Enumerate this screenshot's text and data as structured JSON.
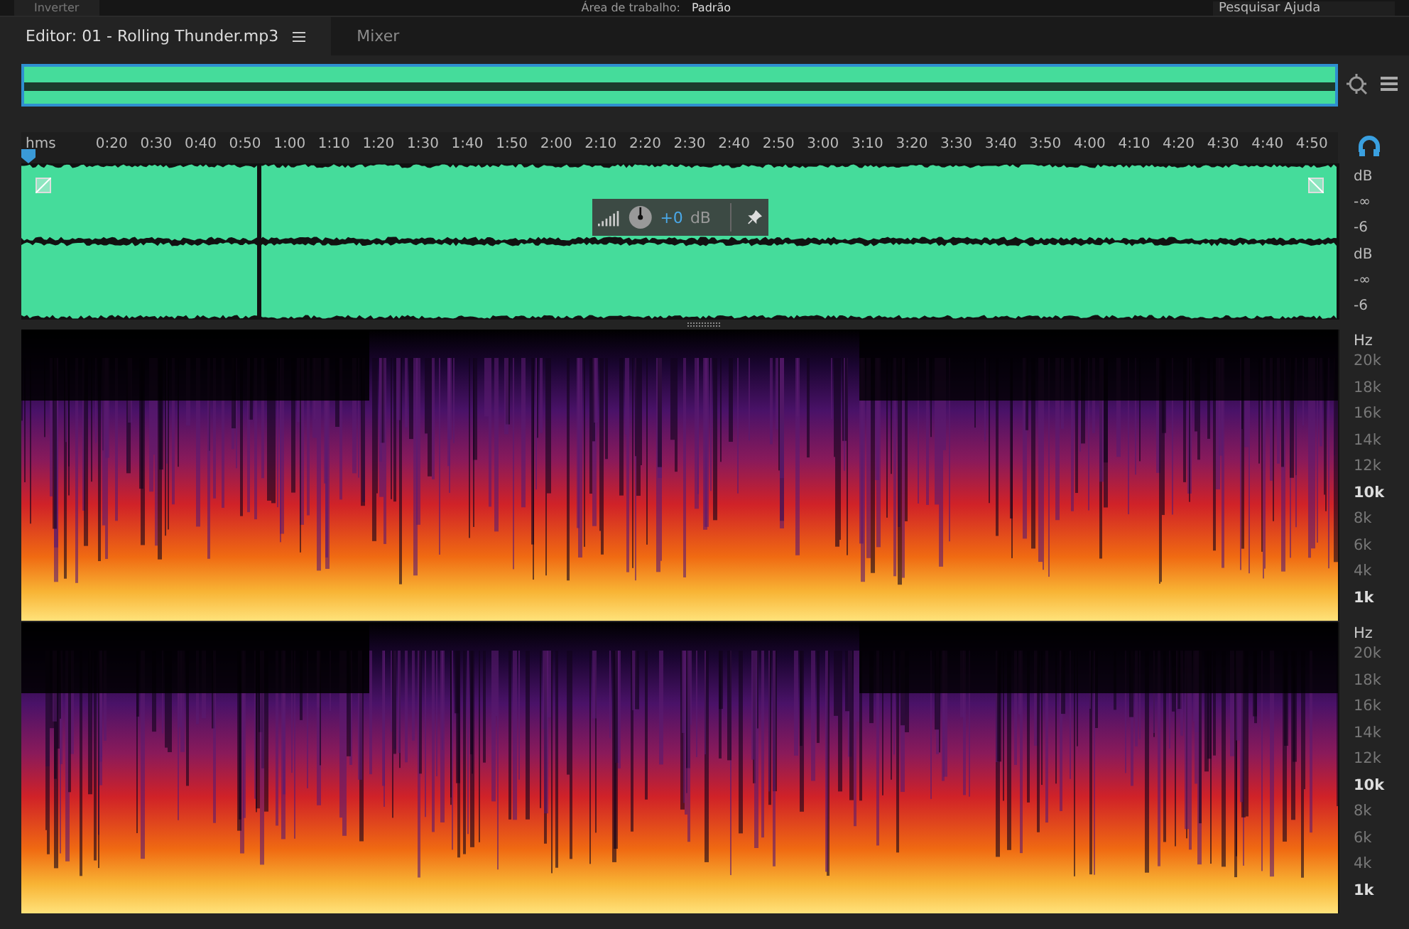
{
  "toolbar": {
    "button": "Inverter",
    "workspace_label": "Área de trabalho:",
    "workspace": "Padrão",
    "search_placeholder": "Pesquisar Ajuda"
  },
  "tabs": [
    {
      "label": "Editor: 01 - Rolling Thunder.mp3",
      "selected": true
    },
    {
      "label": "Mixer",
      "selected": false
    }
  ],
  "ruler": {
    "unit": "hms",
    "ticks": [
      "0:20",
      "0:30",
      "0:40",
      "0:50",
      "1:00",
      "1:10",
      "1:20",
      "1:30",
      "1:40",
      "1:50",
      "2:00",
      "2:10",
      "2:20",
      "2:30",
      "2:40",
      "2:50",
      "3:00",
      "3:10",
      "3:20",
      "3:30",
      "3:40",
      "3:50",
      "4:00",
      "4:10",
      "4:20",
      "4:30",
      "4:40",
      "4:50"
    ]
  },
  "hud": {
    "gain_value": "+0",
    "gain_unit": "dB"
  },
  "amplitude_scales": [
    {
      "unit": "dB",
      "labels": [
        "-∞",
        "-6"
      ]
    },
    {
      "unit": "dB",
      "labels": [
        "-∞",
        "-6"
      ]
    }
  ],
  "frequency_scales": [
    {
      "unit": "Hz",
      "labels": [
        {
          "text": "20k",
          "major": false
        },
        {
          "text": "18k",
          "major": false
        },
        {
          "text": "16k",
          "major": false
        },
        {
          "text": "14k",
          "major": false
        },
        {
          "text": "12k",
          "major": false
        },
        {
          "text": "10k",
          "major": true
        },
        {
          "text": "8k",
          "major": false
        },
        {
          "text": "6k",
          "major": false
        },
        {
          "text": "4k",
          "major": false
        },
        {
          "text": "1k",
          "major": true
        }
      ]
    },
    {
      "unit": "Hz",
      "labels": [
        {
          "text": "20k",
          "major": false
        },
        {
          "text": "18k",
          "major": false
        },
        {
          "text": "16k",
          "major": false
        },
        {
          "text": "14k",
          "major": false
        },
        {
          "text": "12k",
          "major": false
        },
        {
          "text": "10k",
          "major": true
        },
        {
          "text": "8k",
          "major": false
        },
        {
          "text": "6k",
          "major": false
        },
        {
          "text": "4k",
          "major": false
        },
        {
          "text": "1k",
          "major": true
        }
      ]
    }
  ]
}
